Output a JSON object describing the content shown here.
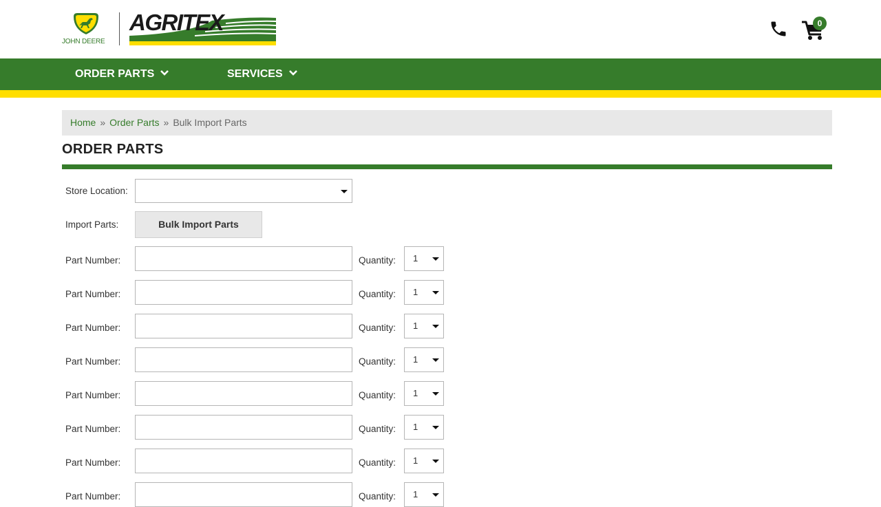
{
  "header": {
    "jd_brand_text": "JOHN DEERE",
    "agritex_brand_text": "AGRITEX",
    "cart_count": "0",
    "phone_icon": "phone-icon",
    "cart_icon": "shopping-cart-icon"
  },
  "nav": {
    "items": [
      {
        "label": "ORDER PARTS",
        "icon": "chevron-down-icon"
      },
      {
        "label": "SERVICES",
        "icon": "chevron-down-icon"
      }
    ]
  },
  "breadcrumb": {
    "items": [
      "Home",
      "Order Parts",
      "Bulk Import Parts"
    ],
    "separator": "»"
  },
  "page": {
    "title": "ORDER PARTS"
  },
  "form": {
    "store_location_label": "Store Location:",
    "store_location_value": "",
    "import_parts_label": "Import Parts:",
    "bulk_import_button": "Bulk Import Parts",
    "part_number_label": "Part Number:",
    "quantity_label": "Quantity:",
    "rows": [
      {
        "part_number": "",
        "quantity": "1"
      },
      {
        "part_number": "",
        "quantity": "1"
      },
      {
        "part_number": "",
        "quantity": "1"
      },
      {
        "part_number": "",
        "quantity": "1"
      },
      {
        "part_number": "",
        "quantity": "1"
      },
      {
        "part_number": "",
        "quantity": "1"
      },
      {
        "part_number": "",
        "quantity": "1"
      },
      {
        "part_number": "",
        "quantity": "1"
      }
    ]
  },
  "colors": {
    "brand_green": "#367c2b",
    "brand_yellow": "#ffde00"
  }
}
